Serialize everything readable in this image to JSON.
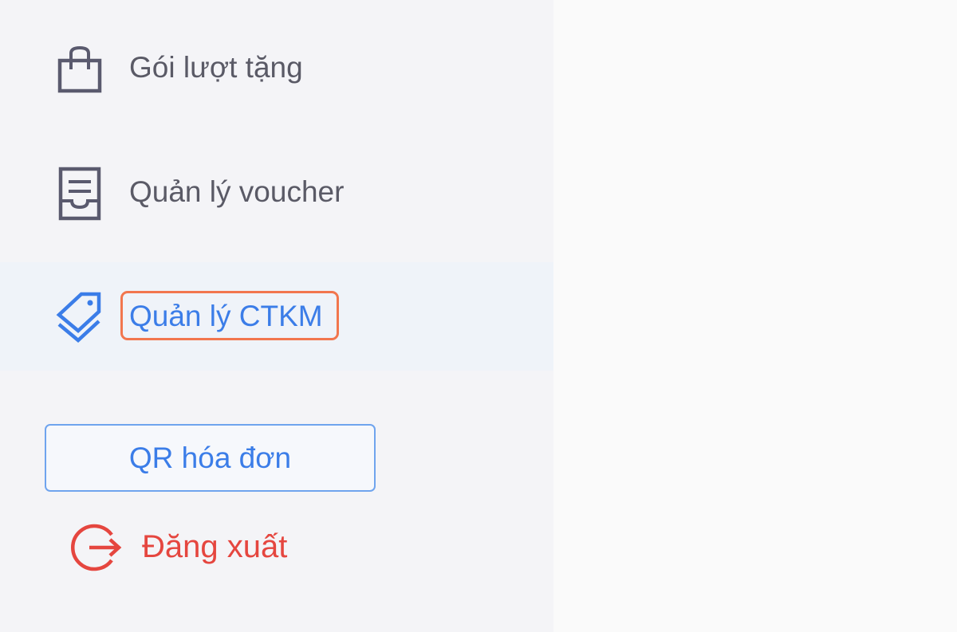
{
  "sidebar": {
    "items": [
      {
        "label": "Gói lượt tặng",
        "icon": "shopping-bag-icon",
        "active": false
      },
      {
        "label": "Quản lý voucher",
        "icon": "receipt-icon",
        "active": false
      },
      {
        "label": "Quản lý CTKM",
        "icon": "tags-icon",
        "active": true
      }
    ],
    "qr_button_label": "QR hóa đơn",
    "logout": {
      "label": "Đăng xuất",
      "icon": "logout-icon"
    }
  },
  "colors": {
    "accent": "#3b7de8",
    "icon_gray": "#5a5a6e",
    "danger": "#e5463f",
    "highlight": "#f2764e"
  }
}
